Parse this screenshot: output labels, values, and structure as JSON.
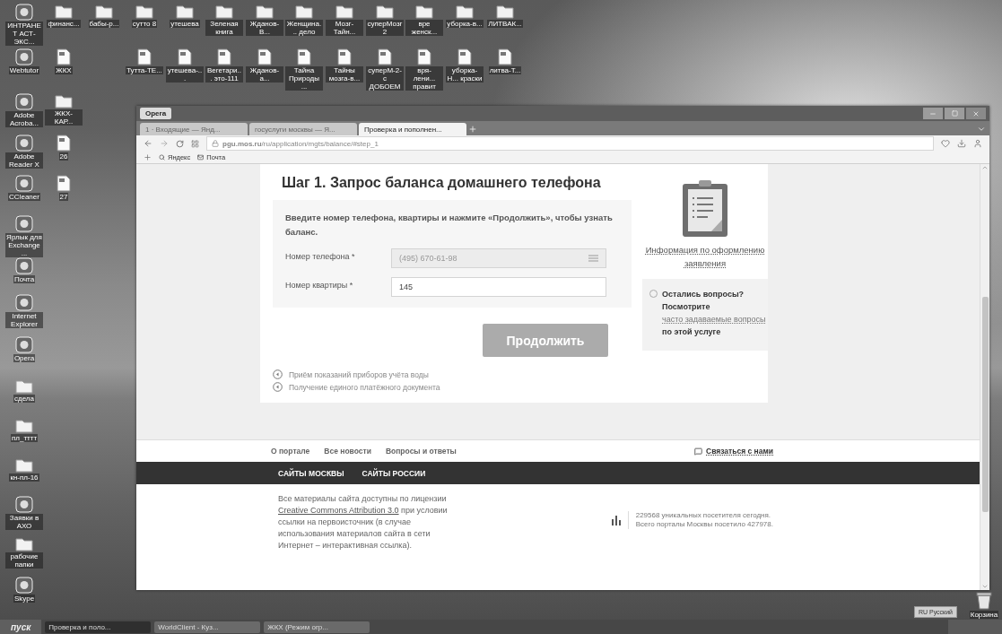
{
  "desktop": {
    "icons": [
      {
        "label": "ИНТРАНЕТ АСТ-ЭКС...",
        "kind": "app"
      },
      {
        "label": "финанс...",
        "kind": "folder"
      },
      {
        "label": "бабы-р...",
        "kind": "folder"
      },
      {
        "label": "сутто 8",
        "kind": "folder"
      },
      {
        "label": "утешева",
        "kind": "folder"
      },
      {
        "label": "Зеленая книга",
        "kind": "folder"
      },
      {
        "label": "Жданов-В...",
        "kind": "folder"
      },
      {
        "label": "Женщина... дело",
        "kind": "folder"
      },
      {
        "label": "Мозг-Тайн...",
        "kind": "folder"
      },
      {
        "label": "суперМозг 2",
        "kind": "folder"
      },
      {
        "label": "вре женск...",
        "kind": "folder"
      },
      {
        "label": "уборка-в...",
        "kind": "folder"
      },
      {
        "label": "ЛИТВАК...",
        "kind": "folder"
      },
      {
        "label": "Webtutor",
        "kind": "app"
      },
      {
        "label": "ЖКХ",
        "kind": "doc"
      },
      {
        "label": "Тутта-ТЕ...",
        "kind": "doc"
      },
      {
        "label": "утешева-...",
        "kind": "doc"
      },
      {
        "label": "Вегетари... это-111",
        "kind": "doc"
      },
      {
        "label": "Жданов-а...",
        "kind": "doc"
      },
      {
        "label": "Тайна Природы ...",
        "kind": "doc"
      },
      {
        "label": "Тайны мозга-в...",
        "kind": "doc"
      },
      {
        "label": "суперМ-2-с ДОБОЕМ",
        "kind": "doc"
      },
      {
        "label": "вря-лени... правит",
        "kind": "doc"
      },
      {
        "label": "уборка-Н... краски",
        "kind": "doc"
      },
      {
        "label": "литва-Т...",
        "kind": "doc"
      },
      {
        "label": "Adobe Acroba...",
        "kind": "app"
      },
      {
        "label": "ЖКХ-КАР...",
        "kind": "folder"
      },
      {
        "label": "Adobe Reader X",
        "kind": "app"
      },
      {
        "label": "26",
        "kind": "doc"
      },
      {
        "label": "CCleaner",
        "kind": "app"
      },
      {
        "label": "27",
        "kind": "doc"
      },
      {
        "label": "Ярлык для Exchange ...",
        "kind": "app"
      },
      {
        "label": "Почта",
        "kind": "app"
      },
      {
        "label": "Internet Explorer",
        "kind": "app"
      },
      {
        "label": "Opera",
        "kind": "app"
      },
      {
        "label": "сдела",
        "kind": "folder"
      },
      {
        "label": "пл_тттт",
        "kind": "folder"
      },
      {
        "label": "кн-пл-16",
        "kind": "folder"
      },
      {
        "label": "Заявки в АХО",
        "kind": "app"
      },
      {
        "label": "рабочие папки",
        "kind": "folder"
      },
      {
        "label": "Skype",
        "kind": "app"
      },
      {
        "label": "Корзина",
        "kind": "bin"
      }
    ]
  },
  "browser": {
    "app_button": "Opera",
    "tabs": [
      {
        "label": "1 · Входящие — Янд...",
        "selected": false
      },
      {
        "label": "госуслуги москвы — Я...",
        "selected": false
      },
      {
        "label": "Проверка и пополнен...",
        "selected": true
      }
    ],
    "address": "**pgu.mos.ru**/ru/application/mgts/balance/#step_1",
    "bookmarks": [
      "Яндекс",
      "Почта"
    ]
  },
  "page": {
    "title": "Шаг 1. Запрос баланса домашнего телефона",
    "intro": "Введите номер телефона, квартиры и нажмите «Продолжить», чтобы узнать баланс.",
    "fields": [
      {
        "label": "Номер телефона *",
        "value": "(495) 670-61-98",
        "disabled": true
      },
      {
        "label": "Номер квартиры *",
        "value": "145",
        "disabled": false
      }
    ],
    "submit": {
      "label": "Продолжить",
      "disabled": true
    },
    "related_links": [
      "Приём показаний приборов учёта воды",
      "Получение единого платёжного документа"
    ],
    "info_link": "Информация по оформлению заявления",
    "help": {
      "before": "Остались вопросы? Посмотрите",
      "link": "часто задаваемые вопросы",
      "after": "по этой услуге"
    }
  },
  "footer": {
    "nav": [
      "О портале",
      "Все новости",
      "Вопросы и ответы"
    ],
    "contact": "Связаться с нами",
    "regions": [
      "САЙТЫ МОСКВЫ",
      "САЙТЫ РОССИИ"
    ],
    "license": {
      "before": "Все материалы сайта доступны по лицензии",
      "link": "Creative Commons Attribution 3.0",
      "after": "при условии ссылки на первоисточник (в случае использования материалов сайта в сети Интернет – интерактивная ссылка)."
    },
    "stats": [
      "229568 уникальных посетителя сегодня.",
      "Всего порталы Москвы посетило 427978."
    ]
  },
  "taskbar": {
    "start": "пуск",
    "tasks": [
      {
        "label": "Проверка и поло...",
        "selected": true
      },
      {
        "label": "WorldClient - Куз...",
        "selected": false
      },
      {
        "label": "ЖКХ (Режим огр...",
        "selected": false
      }
    ],
    "language": "RU Русский"
  }
}
